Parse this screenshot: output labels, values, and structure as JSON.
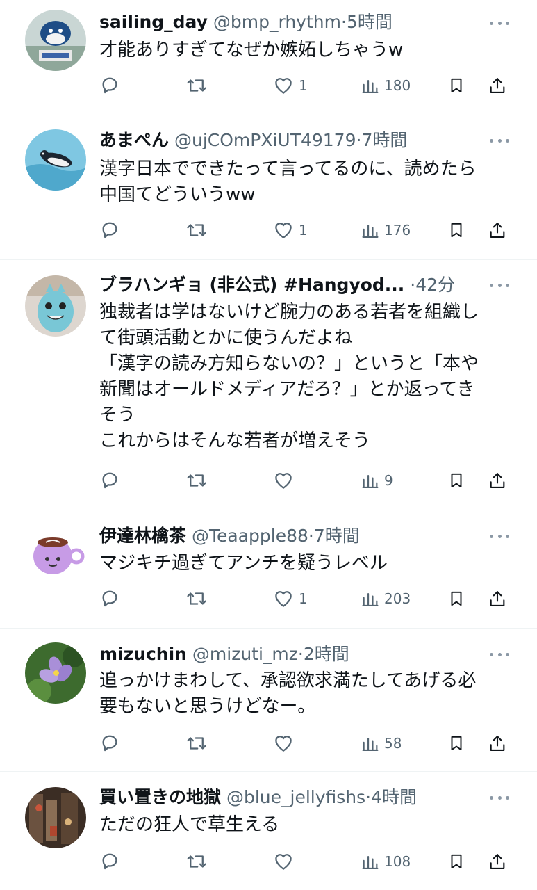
{
  "tweets": [
    {
      "name": "sailing_day",
      "handle": "@bmp_rhythm",
      "sep": "·",
      "time": "5時間",
      "lines": [
        "才能ありすぎてなぜか嫉妬しちゃうw"
      ],
      "likes": "1",
      "views": "180"
    },
    {
      "name": "あまぺん",
      "handle": "@ujCOmPXiUT49179",
      "sep": "·",
      "time": "7時間",
      "lines": [
        "漢字日本でできたって言ってるのに、読めたら",
        "中国てどういうww"
      ],
      "likes": "1",
      "views": "176"
    },
    {
      "name": "ブラハンギョ (非公式) #Hangyod...",
      "handle": "",
      "sep": "·",
      "time": "42分",
      "lines": [
        "独裁者は学はないけど腕力のある若者を組織し",
        "て街頭活動とかに使うんだよね",
        "「漢字の読み方知らないの？」というと「本や",
        "新聞はオールドメディアだろ？」とか返ってき",
        "そう",
        "これからはそんな若者が増えそう"
      ],
      "likes": "",
      "views": "9"
    },
    {
      "name": "伊達林檎茶",
      "handle": "@Teaapple88",
      "sep": "·",
      "time": "7時間",
      "lines": [
        "マジキチ過ぎてアンチを疑うレベル"
      ],
      "likes": "1",
      "views": "203"
    },
    {
      "name": "mizuchin",
      "handle": "@mizuti_mz",
      "sep": "·",
      "time": "2時間",
      "lines": [
        "追っかけまわして、承認欲求満たしてあげる必",
        "要もないと思うけどなー。"
      ],
      "likes": "",
      "views": "58"
    },
    {
      "name": "買い置きの地獄",
      "handle": "@blue_jellyfishs",
      "sep": "·",
      "time": "4時間",
      "lines": [
        "ただの狂人で草生える"
      ],
      "likes": "",
      "views": "108"
    }
  ],
  "icons": {
    "reply": "reply-icon",
    "retweet": "retweet-icon",
    "like": "heart-icon",
    "views": "views-icon",
    "bookmark": "bookmark-icon",
    "share": "share-icon",
    "more": "more-icon"
  },
  "colors": {
    "text": "#0f1419",
    "secondary": "#536471",
    "divider": "#eff3f4"
  }
}
